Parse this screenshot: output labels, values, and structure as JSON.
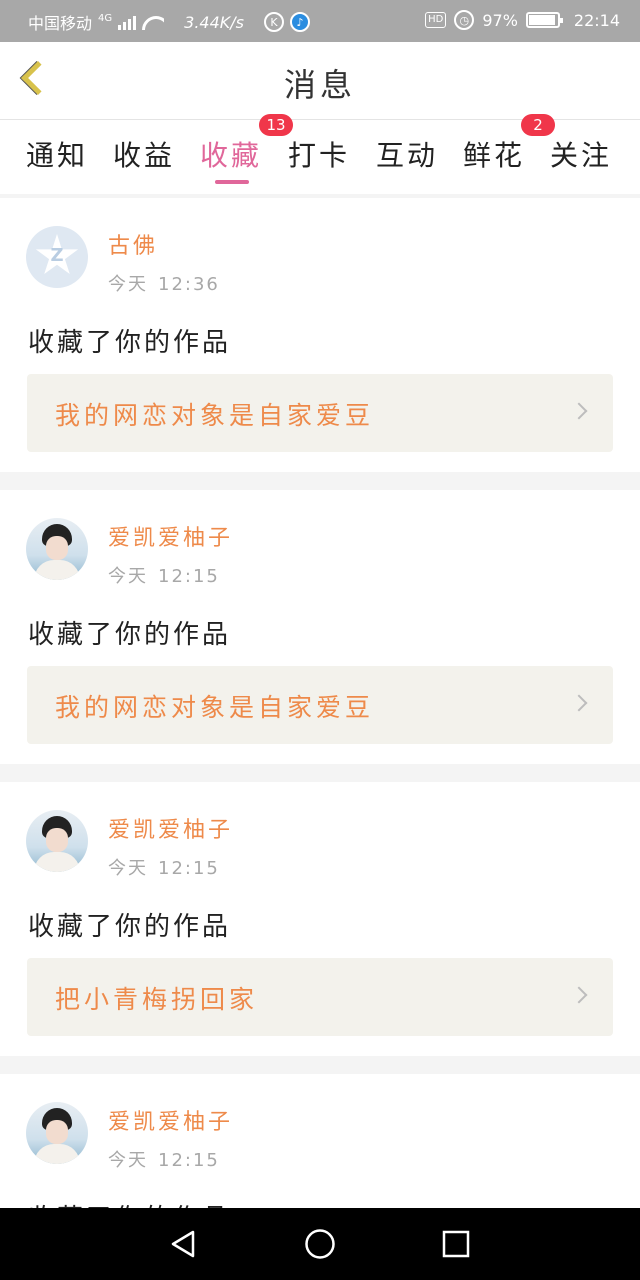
{
  "status_bar": {
    "carrier": "中国移动",
    "network": "4G",
    "speed": "3.44K/s",
    "hd": "HD",
    "battery": "97%",
    "time": "22:14"
  },
  "header": {
    "title": "消息"
  },
  "tabs": [
    {
      "label": "通知"
    },
    {
      "label": "收益"
    },
    {
      "label": "收藏",
      "badge": "13"
    },
    {
      "label": "打卡"
    },
    {
      "label": "互动"
    },
    {
      "label": "鲜花",
      "badge": "2"
    },
    {
      "label": "关注"
    }
  ],
  "items": [
    {
      "username": "古佛",
      "day": "今天",
      "time": "12:36",
      "action": "收藏了你的作品",
      "work": "我的网恋对象是自家爱豆"
    },
    {
      "username": "爱凯爱柚子",
      "day": "今天",
      "time": "12:15",
      "action": "收藏了你的作品",
      "work": "我的网恋对象是自家爱豆"
    },
    {
      "username": "爱凯爱柚子",
      "day": "今天",
      "time": "12:15",
      "action": "收藏了你的作品",
      "work": "把小青梅拐回家"
    },
    {
      "username": "爱凯爱柚子",
      "day": "今天",
      "time": "12:15",
      "action": "收藏了你的作品"
    }
  ],
  "colors": {
    "accent_pink": "#e0679a",
    "accent_orange": "#ee8a4a",
    "badge_red": "#f0364a",
    "back_arrow": "#d8c24c"
  },
  "icons": [
    "back-arrow-icon",
    "signal-icon",
    "wifi-icon",
    "alarm-icon",
    "battery-icon",
    "chevron-right-icon",
    "nav-back-icon",
    "nav-home-icon",
    "nav-recent-icon"
  ]
}
